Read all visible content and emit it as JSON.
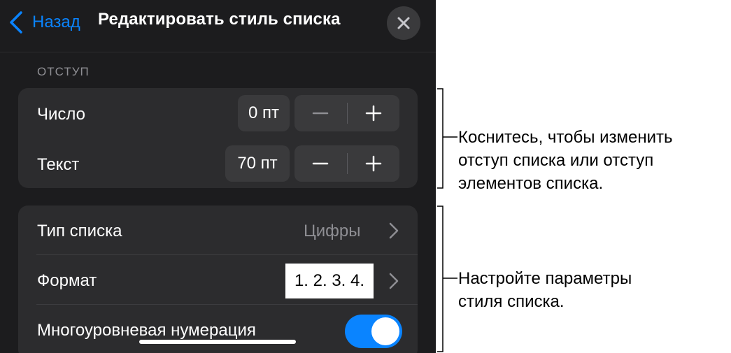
{
  "header": {
    "back_label": "Назад",
    "title": "Редактировать стиль списка",
    "close_icon": "close-icon"
  },
  "indent_section": {
    "label": "ОТСТУП",
    "rows": [
      {
        "label": "Число",
        "value": "0 пт",
        "minus": "minus-icon",
        "plus": "plus-icon"
      },
      {
        "label": "Текст",
        "value": "70 пт",
        "minus": "minus-icon",
        "plus": "plus-icon"
      }
    ]
  },
  "style_section": {
    "list_type": {
      "label": "Тип списка",
      "value": "Цифры"
    },
    "format": {
      "label": "Формат",
      "value": "1. 2. 3. 4."
    },
    "multilevel": {
      "label": "Многоуровневая нумерация",
      "enabled": true
    }
  },
  "callouts": {
    "indent": [
      "Коснитесь, чтобы изменить",
      "отступ списка или отступ",
      "элементов списка."
    ],
    "style": [
      "Настройте параметры",
      "стиля списка."
    ]
  },
  "colors": {
    "panel_bg": "#1c1c1e",
    "group_bg": "#2c2c2e",
    "accent": "#0a84ff"
  }
}
